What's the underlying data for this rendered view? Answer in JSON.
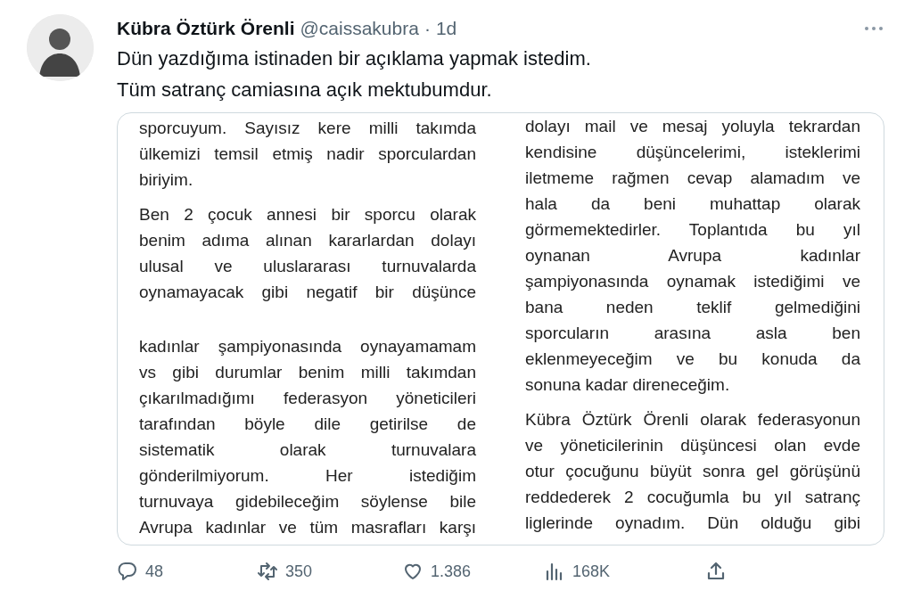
{
  "tweet": {
    "author": "Kübra Öztürk Örenli",
    "handle": "@caissakubra",
    "separator": "·",
    "time": "1d",
    "text": [
      "Dün yazdığıma istinaden bir açıklama yapmak istedim.",
      "Tüm satranç camiasına açık mektubumdur."
    ],
    "media": {
      "columns": [
        {
          "sections": [
            [
              {
                "lines": [
                  "sporcuyum. Sayısız kere milli takımda",
                  "ülkemizi temsil etmiş nadir sporculardan"
                ],
                "last_line": "biriyim."
              },
              {
                "lines": [
                  "Ben 2 çocuk annesi bir sporcu olarak",
                  "benim adıma alınan kararlardan dolayı",
                  "ulusal ve uluslararası turnuvalarda",
                  "oynamayacak gibi negatif bir düşünce"
                ]
              }
            ],
            [
              {
                "lines": [
                  "kadınlar şampiyonasında oynayamamam",
                  "vs gibi durumlar benim milli takımdan",
                  "çıkarılmadığımı federasyon yöneticileri",
                  "tarafından böyle dile getirilse de",
                  "sistematik olarak turnuvalara",
                  "gönderilmiyorum. Her istediğim",
                  "turnuvaya gidebileceğim söylense bile",
                  "Avrupa kadınlar ve tüm masrafları karşı"
                ]
              }
            ]
          ]
        },
        {
          "sections": [
            [
              {
                "lines": [
                  "dolayı mail ve mesaj yoluyla tekrardan",
                  "kendisine düşüncelerimi, isteklerimi",
                  "iletmeme rağmen cevap alamadım ve",
                  "hala da beni muhattap olarak",
                  "görmemektedirler. Toplantıda bu yıl",
                  "oynanan Avrupa kadınlar",
                  "şampiyonasında oynamak istediğimi ve",
                  "bana neden teklif gelmediğini",
                  "sporcuların arasına asla ben",
                  "eklenmeyeceğim ve bu konuda da"
                ],
                "last_line": "sonuna kadar direneceğim."
              },
              {
                "lines": [
                  "Kübra Öztürk Örenli olarak federasyonun",
                  "ve yöneticilerinin düşüncesi olan evde",
                  "otur çocuğunu büyüt sonra gel görüşünü",
                  "reddederek 2 cocuğumla bu yıl satranç",
                  "liglerinde oynadım. Dün olduğu gibi"
                ]
              }
            ]
          ]
        }
      ]
    },
    "actions": [
      {
        "kind": "reply",
        "count": "48"
      },
      {
        "kind": "repost",
        "count": "350"
      },
      {
        "kind": "like",
        "count": "1.386"
      },
      {
        "kind": "views",
        "count": "168K"
      },
      {
        "kind": "share"
      }
    ]
  }
}
